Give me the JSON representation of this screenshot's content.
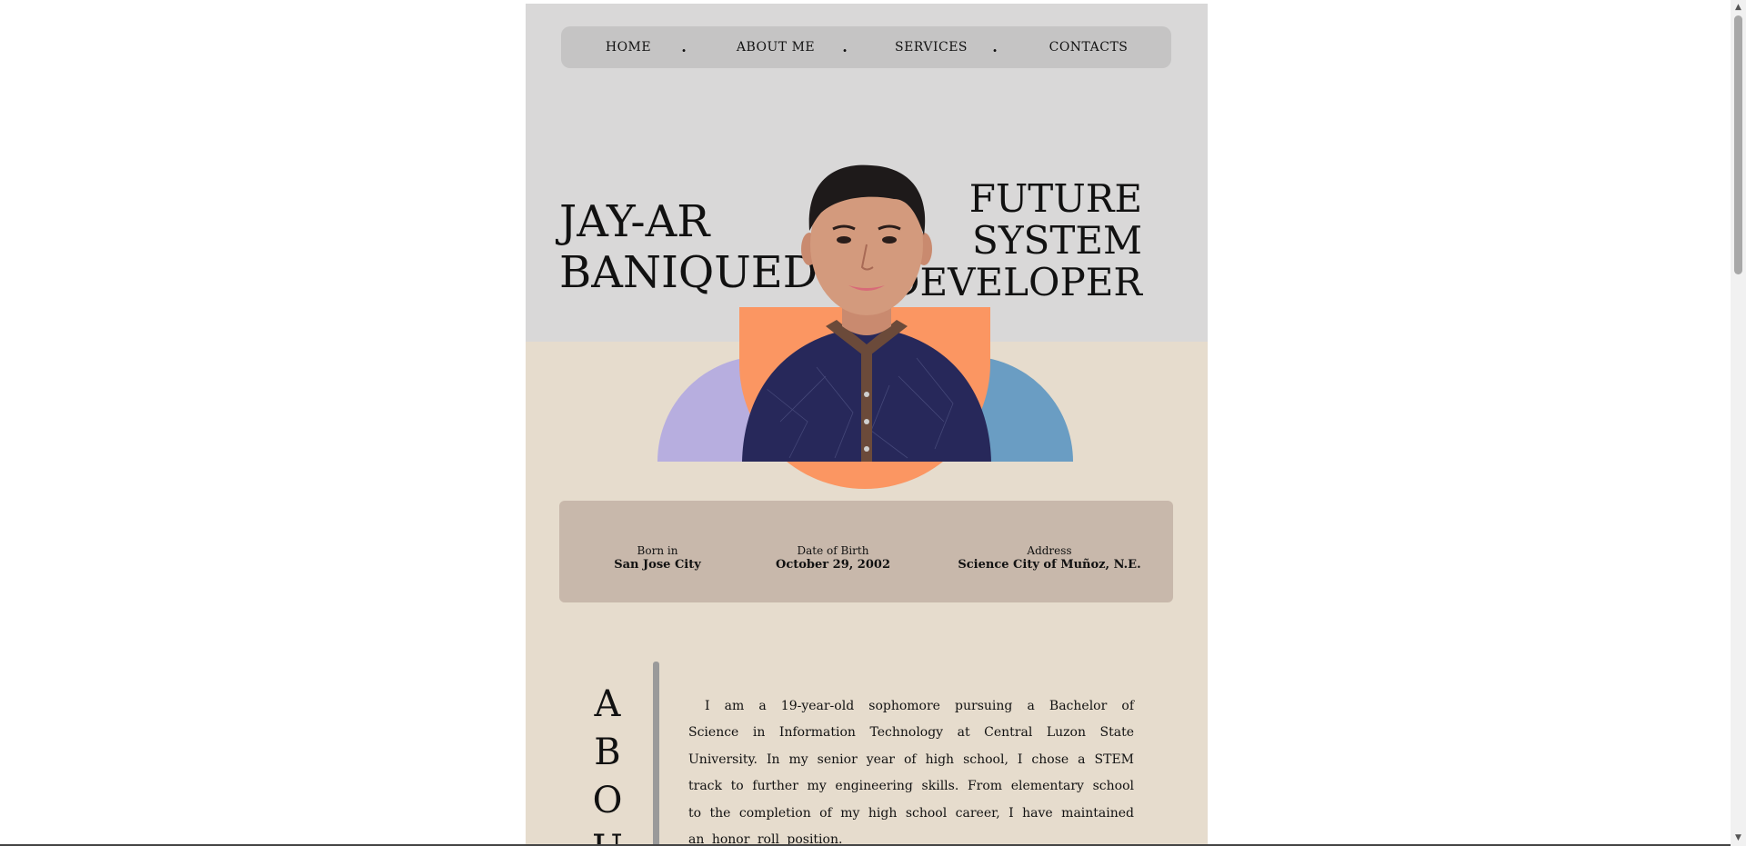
{
  "nav": {
    "items": [
      {
        "label": "HOME"
      },
      {
        "label": "ABOUT ME"
      },
      {
        "label": "SERVICES"
      },
      {
        "label": "CONTACTS"
      }
    ],
    "separator": "."
  },
  "hero": {
    "name_line1": "JAY-AR",
    "name_line2": "BANIQUED",
    "role_line1": "FUTURE",
    "role_line2": "SYSTEM",
    "role_line3": "DEVELOPER"
  },
  "info": {
    "born": {
      "label": "Born in",
      "value": "San Jose City"
    },
    "dob": {
      "label": "Date of Birth",
      "value": "October 29, 2002"
    },
    "address": {
      "label": "Address",
      "value": "Science City of Muñoz, N.E."
    }
  },
  "about": {
    "letters": [
      "A",
      "B",
      "O",
      "U"
    ],
    "text": "I am a 19-year-old sophomore pursuing a Bachelor of Science in Information Technology at Central Luzon State University. In my senior year of high school, I chose a STEM track to further my engineering skills. From elementary school to the completion of my high school career, I have maintained an honor roll position."
  },
  "colors": {
    "hero_bg": "#d9d8d8",
    "page_bg": "#e6dccd",
    "nav_bg": "#c5c4c4",
    "info_bg": "#c8b8ab",
    "orange": "#fb9662",
    "purple": "#b7aedf",
    "blue": "#6a9dc3"
  }
}
